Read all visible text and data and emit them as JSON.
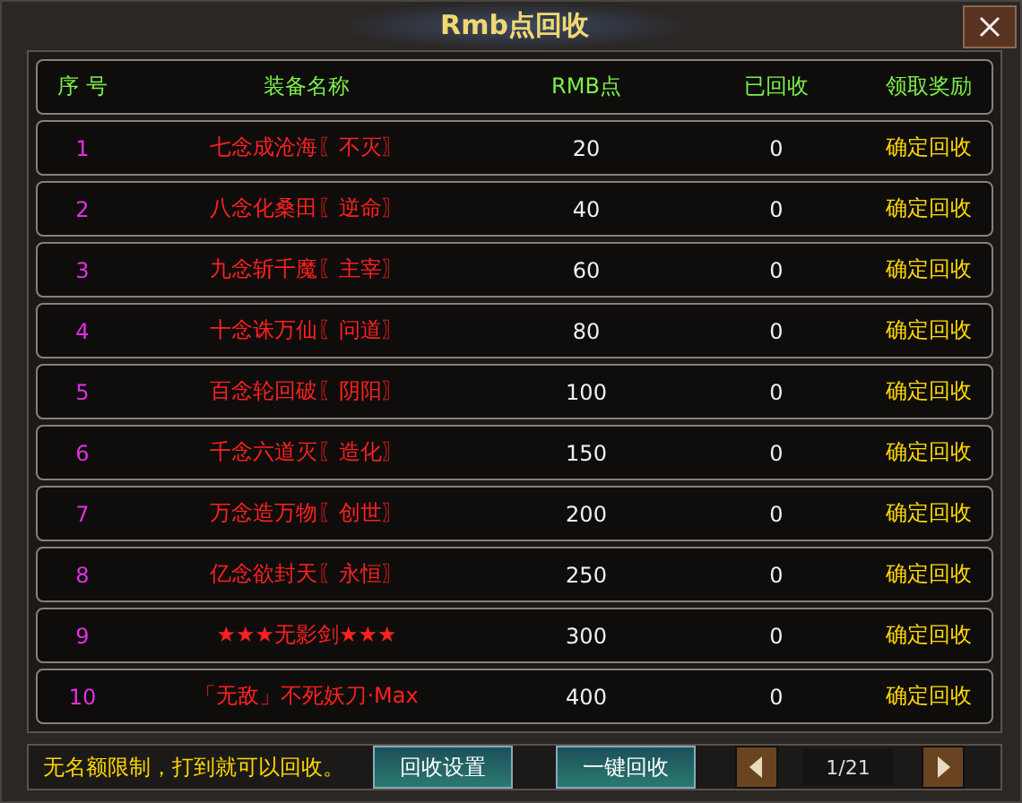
{
  "window": {
    "title": "Rmb点回收"
  },
  "table": {
    "columns": [
      "序 号",
      "装备名称",
      "RMB点",
      "已回收",
      "领取奖励"
    ],
    "rows": [
      {
        "index": "1",
        "name": "七念成沧海〖不灭〗",
        "points": "20",
        "recycled": "0",
        "action": "确定回收"
      },
      {
        "index": "2",
        "name": "八念化桑田〖逆命〗",
        "points": "40",
        "recycled": "0",
        "action": "确定回收"
      },
      {
        "index": "3",
        "name": "九念斩千魔〖主宰〗",
        "points": "60",
        "recycled": "0",
        "action": "确定回收"
      },
      {
        "index": "4",
        "name": "十念诛万仙〖问道〗",
        "points": "80",
        "recycled": "0",
        "action": "确定回收"
      },
      {
        "index": "5",
        "name": "百念轮回破〖阴阳〗",
        "points": "100",
        "recycled": "0",
        "action": "确定回收"
      },
      {
        "index": "6",
        "name": "千念六道灭〖造化〗",
        "points": "150",
        "recycled": "0",
        "action": "确定回收"
      },
      {
        "index": "7",
        "name": "万念造万物〖创世〗",
        "points": "200",
        "recycled": "0",
        "action": "确定回收"
      },
      {
        "index": "8",
        "name": "亿念欲封天〖永恒〗",
        "points": "250",
        "recycled": "0",
        "action": "确定回收"
      },
      {
        "index": "9",
        "name": "★★★无影剑★★★",
        "points": "300",
        "recycled": "0",
        "action": "确定回收"
      },
      {
        "index": "10",
        "name": "「无敌」不死妖刀·Max",
        "points": "400",
        "recycled": "0",
        "action": "确定回收"
      }
    ]
  },
  "footer": {
    "note": "无名额限制，打到就可以回收。",
    "buttons": [
      "回收设置",
      "一键回收"
    ],
    "page": "1/21"
  }
}
